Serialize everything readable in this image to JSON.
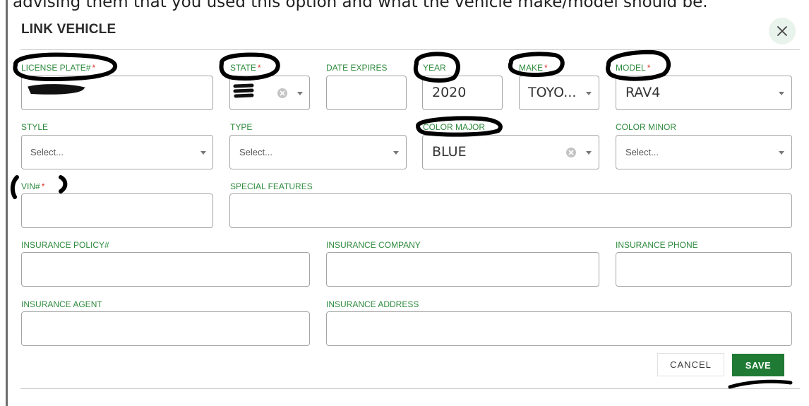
{
  "background_text": "advising them that you used this option and what the vehicle make/model should be.",
  "dialog": {
    "title": "LINK VEHICLE",
    "close_symbol": "×"
  },
  "fields": {
    "license_plate": {
      "label": "LICENSE PLATE#",
      "required_mark": "*",
      "value": ""
    },
    "state": {
      "label": "STATE",
      "required_mark": "*",
      "value": ""
    },
    "date_expires": {
      "label": "DATE EXPIRES",
      "value": ""
    },
    "year": {
      "label": "YEAR",
      "value": "2020"
    },
    "make": {
      "label": "MAKE",
      "required_mark": "*",
      "value": "TOYO..."
    },
    "model": {
      "label": "MODEL",
      "required_mark": "*",
      "value": "RAV4"
    },
    "style": {
      "label": "STYLE",
      "placeholder": "Select..."
    },
    "type": {
      "label": "TYPE",
      "placeholder": "Select..."
    },
    "color_major": {
      "label": "COLOR MAJOR",
      "value": "BLUE"
    },
    "color_minor": {
      "label": "COLOR MINOR",
      "placeholder": "Select..."
    },
    "vin": {
      "label": "VIN#",
      "required_mark": "*",
      "value": ""
    },
    "special_features": {
      "label": "SPECIAL FEATURES",
      "value": ""
    },
    "insurance_policy": {
      "label": "INSURANCE POLICY#",
      "value": ""
    },
    "insurance_company": {
      "label": "INSURANCE COMPANY",
      "value": ""
    },
    "insurance_phone": {
      "label": "INSURANCE PHONE",
      "value": ""
    },
    "insurance_agent": {
      "label": "INSURANCE AGENT",
      "value": ""
    },
    "insurance_address": {
      "label": "INSURANCE ADDRESS",
      "value": ""
    }
  },
  "actions": {
    "cancel_label": "CANCEL",
    "save_label": "SAVE"
  },
  "colors": {
    "label_green": "#2e8b3e",
    "required_red": "#d93025",
    "save_bg": "#1f7a34",
    "close_bg": "#e8f3ec"
  },
  "icons": {
    "close": "close-icon",
    "dropdown": "chevron-down-icon",
    "clear": "clear-circle-icon"
  }
}
